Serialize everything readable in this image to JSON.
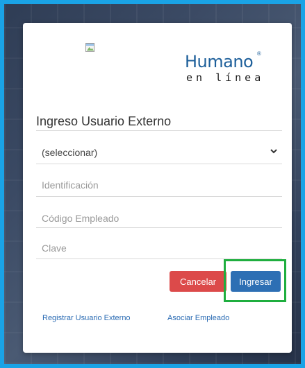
{
  "colors": {
    "page_border": "#1aa3e6",
    "cancel_button": "#dc4a4a",
    "submit_button": "#2d6fb4",
    "highlight": "#1fae3f",
    "link": "#2a6bb3",
    "logo_blue": "#1d5f9a"
  },
  "logo": {
    "brand": "Humano",
    "registered": "®",
    "tagline": "en línea"
  },
  "form": {
    "title": "Ingreso Usuario Externo",
    "doc_type_select": {
      "value": "(seleccionar)"
    },
    "identification_placeholder": "Identificación",
    "employee_code_placeholder": "Código Empleado",
    "password_placeholder": "Clave"
  },
  "buttons": {
    "cancel": "Cancelar",
    "submit": "Ingresar"
  },
  "links": {
    "register": "Registrar Usuario Externo",
    "associate": "Asociar Empleado"
  },
  "icons": {
    "broken_image": "broken-image-icon",
    "select_chevron": "chevron-down-icon"
  }
}
